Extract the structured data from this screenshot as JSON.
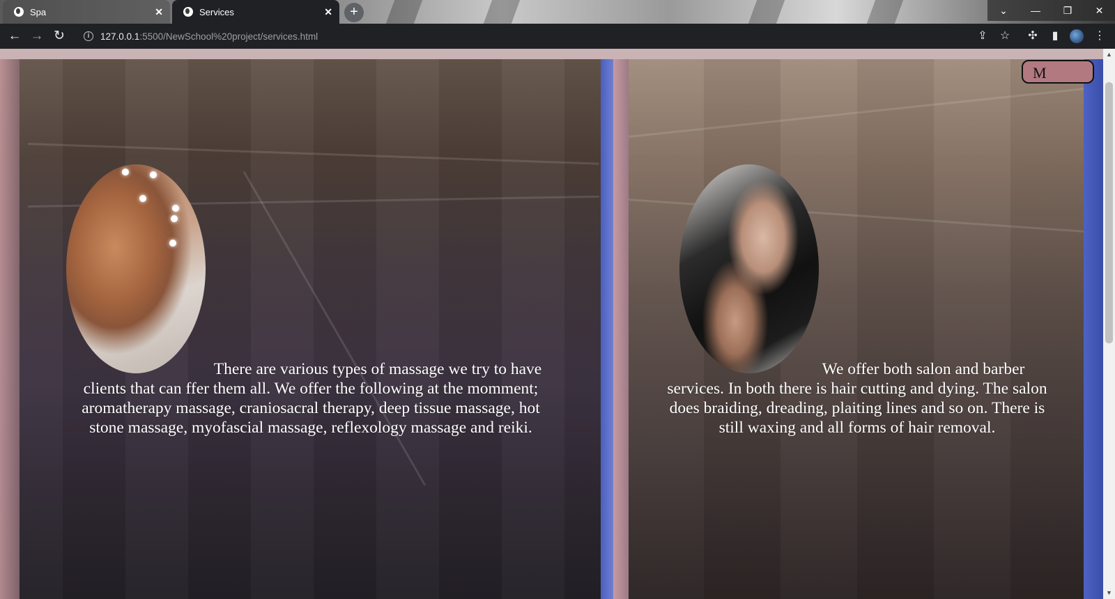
{
  "browser": {
    "tabs": [
      {
        "label": "Spa",
        "active": false
      },
      {
        "label": "Services",
        "active": true
      }
    ],
    "new_tab_symbol": "+",
    "close_symbol": "✕",
    "url_host": "127.0.0.1",
    "url_path": ":5500/NewSchool%20project/services.html",
    "nav": {
      "back": "←",
      "forward": "→",
      "reload": "↻"
    },
    "window_controls": {
      "tab_search": "⌄",
      "minimize": "—",
      "restore": "❐",
      "close": "✕"
    },
    "toolbar_icons": {
      "share": "⇪",
      "bookmark": "☆",
      "extensions": "✣",
      "side_panel": "▮",
      "menu": "⋮"
    }
  },
  "page": {
    "menu_button_label": "M",
    "services": [
      {
        "id": "massage",
        "image": "massage-photo",
        "text": "There are various types of massage we try to have clients that can ffer them all. We offer the following at the momment; aromatherapy massage, craniosacral therapy, deep tissue massage, hot stone massage, myofascial massage, reflexology massage and reiki."
      },
      {
        "id": "hair",
        "image": "hair-wash-photo",
        "text": "We offer both salon and barber services. In both there is hair cutting and dying. The salon does braiding, dreading, plaiting lines and so on. There is still waxing and all forms of hair removal."
      }
    ],
    "colors": {
      "menu_button_bg": "#b27a80",
      "accent_blue": "#4a5fbf",
      "accent_pink": "#c99aa0"
    }
  },
  "scrollbar": {
    "up": "▲",
    "down": "▼"
  }
}
